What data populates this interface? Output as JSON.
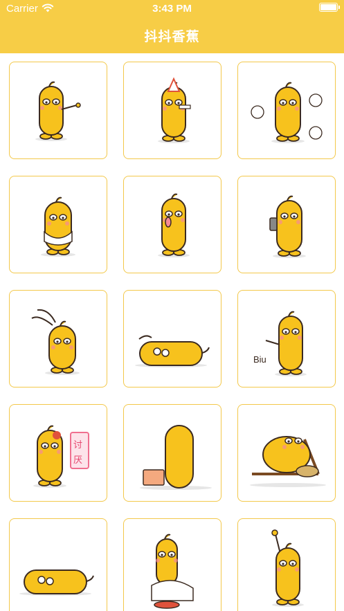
{
  "status_bar": {
    "carrier": "Carrier",
    "time": "3:43 PM"
  },
  "nav": {
    "title": "抖抖香蕉"
  },
  "colors": {
    "header": "#f7cd46",
    "cell_border": "#f3c84a",
    "banana": "#f7c21d",
    "outline": "#3b2a20"
  },
  "stickers": [
    {
      "name": "pointing",
      "text": ""
    },
    {
      "name": "party-horn",
      "text": ""
    },
    {
      "name": "surrounded-by-speech",
      "text": ""
    },
    {
      "name": "bandaged-shy",
      "text": ""
    },
    {
      "name": "surprised-mouth-open",
      "text": ""
    },
    {
      "name": "phone-call",
      "text": ""
    },
    {
      "name": "flopping-over",
      "text": ""
    },
    {
      "name": "lying-down",
      "text": ""
    },
    {
      "name": "finger-gun",
      "text": "Biu"
    },
    {
      "name": "annoyed-sign",
      "text": "讨厌"
    },
    {
      "name": "back-with-laptop",
      "text": ""
    },
    {
      "name": "lounging-with-snacks",
      "text": ""
    },
    {
      "name": "lying-flat",
      "text": ""
    },
    {
      "name": "riding-horse",
      "text": ""
    },
    {
      "name": "raising-hand",
      "text": ""
    }
  ]
}
